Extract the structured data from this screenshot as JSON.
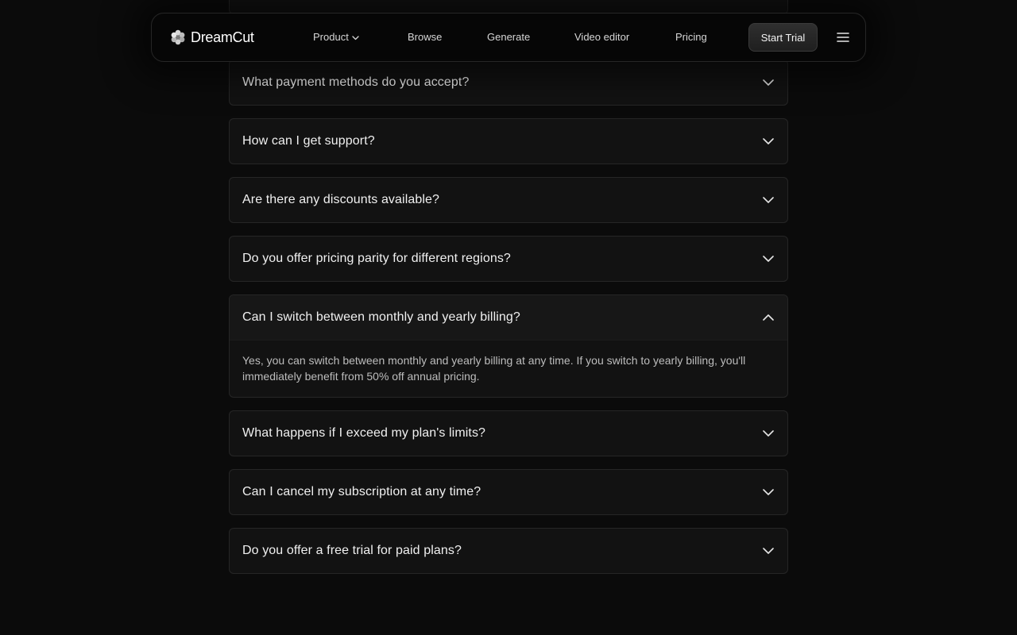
{
  "nav": {
    "brand": "DreamCut",
    "links": {
      "product": "Product",
      "browse": "Browse",
      "generate": "Generate",
      "video_editor": "Video editor",
      "pricing": "Pricing"
    },
    "cta_label": "Start Trial",
    "menu_icon": "hamburger-menu-icon"
  },
  "faq": {
    "items": [
      {
        "question": "",
        "expanded": false,
        "partially_hidden": true
      },
      {
        "question": "What payment methods do you accept?",
        "expanded": false
      },
      {
        "question": "How can I get support?",
        "expanded": false
      },
      {
        "question": "Are there any discounts available?",
        "expanded": false
      },
      {
        "question": "Do you offer pricing parity for different regions?",
        "expanded": false
      },
      {
        "question": "Can I switch between monthly and yearly billing?",
        "expanded": true,
        "answer": "Yes, you can switch between monthly and yearly billing at any time. If you switch to yearly billing, you'll immediately benefit from 50% off annual pricing."
      },
      {
        "question": "What happens if I exceed my plan's limits?",
        "expanded": false
      },
      {
        "question": "Can I cancel my subscription at any time?",
        "expanded": false
      },
      {
        "question": "Do you offer a free trial for paid plans?",
        "expanded": false
      }
    ]
  },
  "colors": {
    "background": "#0b0b0b",
    "card": "#121212",
    "border": "#262626",
    "text": "#f0f0f0",
    "muted_text": "#bdbdbd"
  }
}
